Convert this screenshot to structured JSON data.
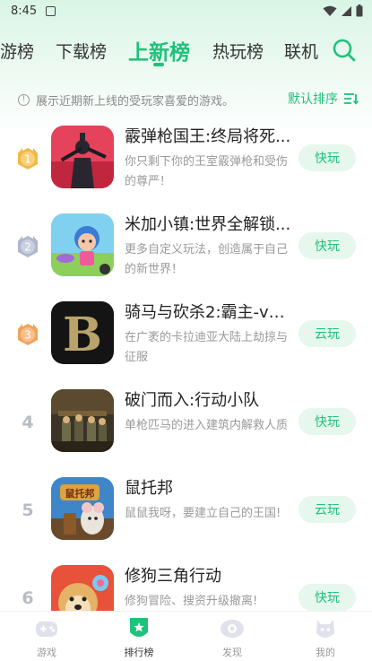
{
  "status_bar": {
    "time": "8:45"
  },
  "tabs": [
    {
      "label": "游榜",
      "active": false
    },
    {
      "label": "下载榜",
      "active": false
    },
    {
      "label": "上新榜",
      "active": true
    },
    {
      "label": "热玩榜",
      "active": false
    },
    {
      "label": "联机",
      "active": false
    }
  ],
  "info": {
    "text": "展示近期新上线的受玩家喜爱的游戏。",
    "sort_label": "默认排序"
  },
  "games": [
    {
      "rank": "1",
      "title": "霰弹枪国王:终局将死...",
      "desc": "你只剩下你的王室霰弹枪和受伤的尊严！",
      "button": "快玩"
    },
    {
      "rank": "2",
      "title": "米加小镇:世界全解锁...",
      "desc": "更多自定义玩法，创造属于自己的新世界！",
      "button": "快玩"
    },
    {
      "rank": "3",
      "title": "骑马与砍杀2:霸主-v1....",
      "desc": "在广袤的卡拉迪亚大陆上劫掠与征服",
      "button": "云玩"
    },
    {
      "rank": "4",
      "title": "破门而入:行动小队",
      "desc": "单枪匹马的进入建筑内解救人质",
      "button": "快玩"
    },
    {
      "rank": "5",
      "title": "鼠托邦",
      "desc": "鼠鼠我呀，要建立自己的王国!",
      "button": "云玩"
    },
    {
      "rank": "6",
      "title": "修狗三角行动",
      "desc": "修狗冒险、搜资升级撤离!",
      "button": "快玩"
    }
  ],
  "bottom_nav": [
    {
      "label": "游戏",
      "active": false
    },
    {
      "label": "排行榜",
      "active": true
    },
    {
      "label": "发现",
      "active": false
    },
    {
      "label": "我的",
      "active": false
    }
  ],
  "thumb_text": {
    "game5": "鼠托邦"
  },
  "colors": {
    "accent": "#1ec27a",
    "button_bg": "#e6f7ee",
    "gold": "#f3b843",
    "silver": "#aeb7cf",
    "bronze": "#f0a35a"
  }
}
